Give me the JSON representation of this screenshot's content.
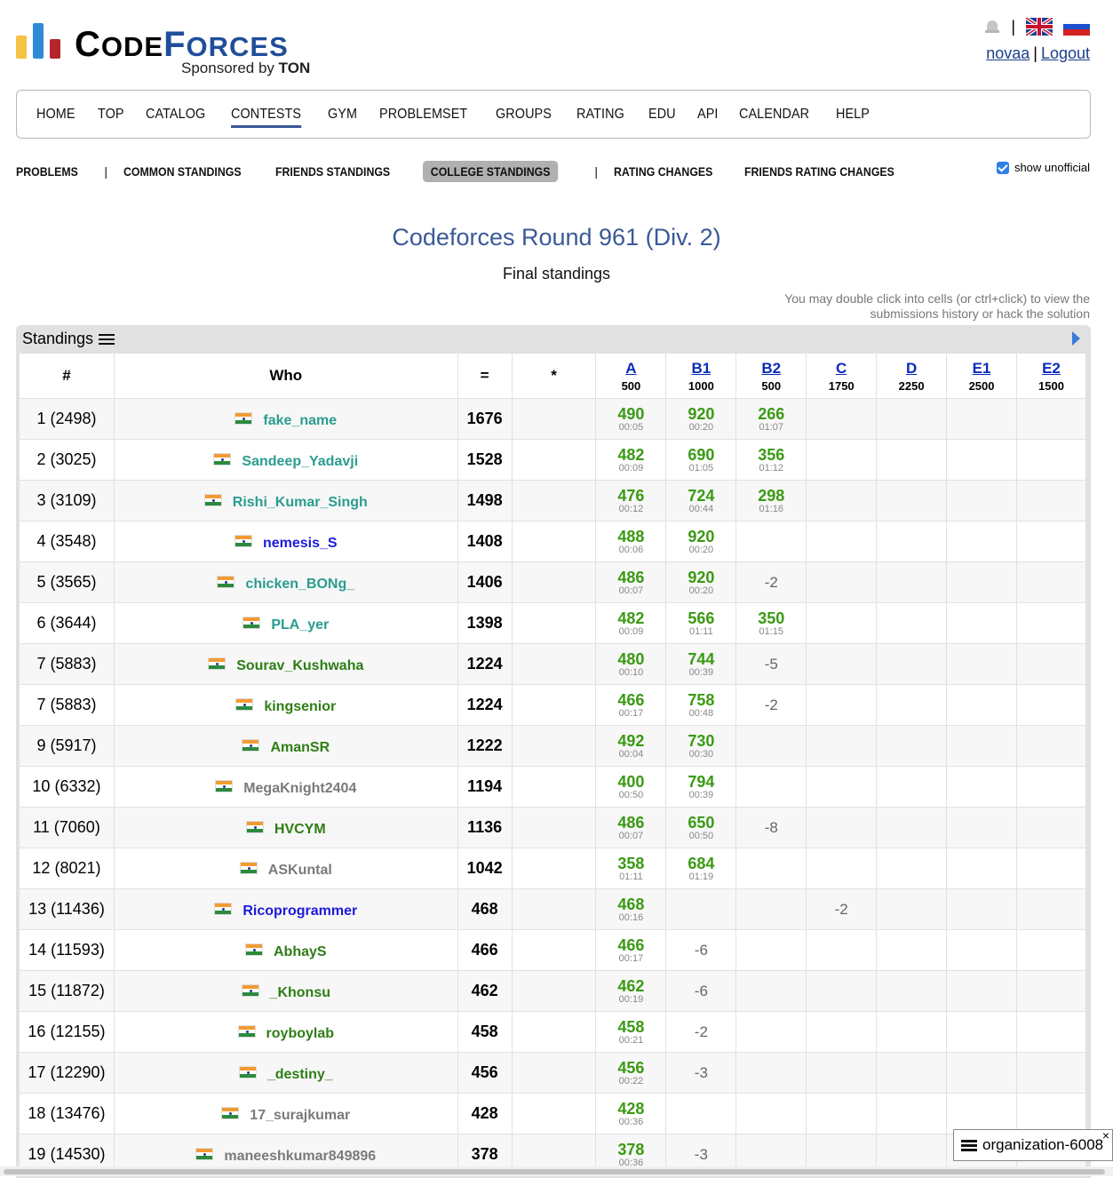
{
  "brand": {
    "word1": "Code",
    "word2": "forces",
    "sponsor_prefix": "Sponsored by",
    "sponsor_name": "TON"
  },
  "auth": {
    "user": "novaa",
    "separator": "|",
    "logout": "Logout"
  },
  "top_icons": [
    "bell-icon",
    "uk-flag-icon",
    "ru-flag-icon"
  ],
  "nav": [
    "HOME",
    "TOP",
    "CATALOG",
    "CONTESTS",
    "GYM",
    "PROBLEMSET",
    "GROUPS",
    "RATING",
    "EDU",
    "API",
    "CALENDAR",
    "HELP"
  ],
  "nav_active": "CONTESTS",
  "subnav": {
    "problems": "PROBLEMS",
    "pipe": "|",
    "common": "COMMON STANDINGS",
    "friends": "FRIENDS STANDINGS",
    "college": "COLLEGE STANDINGS",
    "rating_changes": "RATING CHANGES",
    "friends_rating": "FRIENDS RATING CHANGES",
    "show_unofficial": "show unofficial"
  },
  "contest": {
    "title": "Codeforces Round 961 (Div. 2)",
    "subtitle": "Final standings",
    "hint": "You may double click into cells (or ctrl+click) to view the submissions history or hack the solution"
  },
  "standings": {
    "label": "Standings",
    "col_rank": "#",
    "col_who": "Who",
    "col_score": "=",
    "col_penalty": "*",
    "problems": [
      {
        "id": "A",
        "pts": "500",
        "link": true
      },
      {
        "id": "B1",
        "pts": "1000",
        "link": true
      },
      {
        "id": "B2",
        "pts": "500",
        "link": true
      },
      {
        "id": "C",
        "pts": "1750",
        "link": true
      },
      {
        "id": "D",
        "pts": "2250",
        "link": true
      },
      {
        "id": "E1",
        "pts": "2500",
        "link": true
      },
      {
        "id": "E2",
        "pts": "1500",
        "link": true
      }
    ],
    "rows": [
      {
        "rank": "1 (2498)",
        "handle": "fake_name",
        "color": "cyan",
        "score": "1676",
        "cells": [
          [
            "490",
            "00:05"
          ],
          [
            "920",
            "00:20"
          ],
          [
            "266",
            "01:07"
          ],
          null,
          null,
          null,
          null
        ]
      },
      {
        "rank": "2 (3025)",
        "handle": "Sandeep_Yadavji",
        "color": "cyan",
        "score": "1528",
        "cells": [
          [
            "482",
            "00:09"
          ],
          [
            "690",
            "01:05"
          ],
          [
            "356",
            "01:12"
          ],
          null,
          null,
          null,
          null
        ]
      },
      {
        "rank": "3 (3109)",
        "handle": "Rishi_Kumar_Singh",
        "color": "cyan",
        "score": "1498",
        "cells": [
          [
            "476",
            "00:12"
          ],
          [
            "724",
            "00:44"
          ],
          [
            "298",
            "01:16"
          ],
          null,
          null,
          null,
          null
        ]
      },
      {
        "rank": "4 (3548)",
        "handle": "nemesis_S",
        "color": "blue",
        "score": "1408",
        "cells": [
          [
            "488",
            "00:06"
          ],
          [
            "920",
            "00:20"
          ],
          null,
          null,
          null,
          null,
          null
        ]
      },
      {
        "rank": "5 (3565)",
        "handle": "chicken_BONg_",
        "color": "cyan",
        "score": "1406",
        "cells": [
          [
            "486",
            "00:07"
          ],
          [
            "920",
            "00:20"
          ],
          "-2",
          null,
          null,
          null,
          null
        ]
      },
      {
        "rank": "6 (3644)",
        "handle": "PLA_yer",
        "color": "cyan",
        "score": "1398",
        "cells": [
          [
            "482",
            "00:09"
          ],
          [
            "566",
            "01:11"
          ],
          [
            "350",
            "01:15"
          ],
          null,
          null,
          null,
          null
        ]
      },
      {
        "rank": "7 (5883)",
        "handle": "Sourav_Kushwaha",
        "color": "green",
        "score": "1224",
        "cells": [
          [
            "480",
            "00:10"
          ],
          [
            "744",
            "00:39"
          ],
          "-5",
          null,
          null,
          null,
          null
        ]
      },
      {
        "rank": "7 (5883)",
        "handle": "kingsenior",
        "color": "green",
        "score": "1224",
        "cells": [
          [
            "466",
            "00:17"
          ],
          [
            "758",
            "00:48"
          ],
          "-2",
          null,
          null,
          null,
          null
        ]
      },
      {
        "rank": "9 (5917)",
        "handle": "AmanSR",
        "color": "green",
        "score": "1222",
        "cells": [
          [
            "492",
            "00:04"
          ],
          [
            "730",
            "00:30"
          ],
          null,
          null,
          null,
          null,
          null
        ]
      },
      {
        "rank": "10 (6332)",
        "handle": "MegaKnight2404",
        "color": "gray",
        "score": "1194",
        "cells": [
          [
            "400",
            "00:50"
          ],
          [
            "794",
            "00:39"
          ],
          null,
          null,
          null,
          null,
          null
        ]
      },
      {
        "rank": "11 (7060)",
        "handle": "HVCYM",
        "color": "green",
        "score": "1136",
        "cells": [
          [
            "486",
            "00:07"
          ],
          [
            "650",
            "00:50"
          ],
          "-8",
          null,
          null,
          null,
          null
        ]
      },
      {
        "rank": "12 (8021)",
        "handle": "ASKuntal",
        "color": "gray",
        "score": "1042",
        "cells": [
          [
            "358",
            "01:11"
          ],
          [
            "684",
            "01:19"
          ],
          null,
          null,
          null,
          null,
          null
        ]
      },
      {
        "rank": "13 (11436)",
        "handle": "Ricoprogrammer",
        "color": "blue",
        "score": "468",
        "cells": [
          [
            "468",
            "00:16"
          ],
          null,
          null,
          "-2",
          null,
          null,
          null
        ]
      },
      {
        "rank": "14 (11593)",
        "handle": "AbhayS",
        "color": "green",
        "score": "466",
        "cells": [
          [
            "466",
            "00:17"
          ],
          "-6",
          null,
          null,
          null,
          null,
          null
        ]
      },
      {
        "rank": "15 (11872)",
        "handle": "_Khonsu",
        "color": "green",
        "score": "462",
        "cells": [
          [
            "462",
            "00:19"
          ],
          "-6",
          null,
          null,
          null,
          null,
          null
        ]
      },
      {
        "rank": "16 (12155)",
        "handle": "royboylab",
        "color": "green",
        "score": "458",
        "cells": [
          [
            "458",
            "00:21"
          ],
          "-2",
          null,
          null,
          null,
          null,
          null
        ]
      },
      {
        "rank": "17 (12290)",
        "handle": "_destiny_",
        "color": "green",
        "score": "456",
        "cells": [
          [
            "456",
            "00:22"
          ],
          "-3",
          null,
          null,
          null,
          null,
          null
        ]
      },
      {
        "rank": "18 (13476)",
        "handle": "17_surajkumar",
        "color": "gray",
        "score": "428",
        "cells": [
          [
            "428",
            "00:36"
          ],
          null,
          null,
          null,
          null,
          null,
          null
        ]
      },
      {
        "rank": "19 (14530)",
        "handle": "maneeshkumar849896",
        "color": "gray",
        "score": "378",
        "cells": [
          [
            "378",
            "00:36"
          ],
          "-3",
          null,
          null,
          null,
          null,
          null
        ]
      }
    ]
  },
  "org_popup": {
    "label": "organization-6008",
    "close": "×"
  },
  "colors": {
    "accent": "#3b5998",
    "accepted": "#3a9a13",
    "link": "#0b2bb8"
  }
}
